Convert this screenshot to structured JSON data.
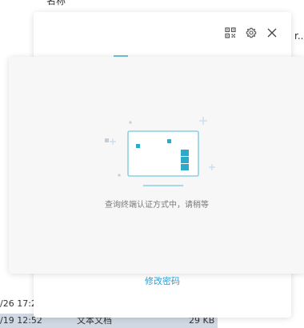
{
  "explorer": {
    "column_name": "名称",
    "right_text": "r...",
    "rows": [
      {
        "date": "/26 17:2",
        "type": "",
        "size": ""
      },
      {
        "date": "/19 12:52",
        "type": "文本文档",
        "size": "29 KB"
      }
    ]
  },
  "login_window": {
    "icons": [
      "qr-code-icon",
      "gear-icon",
      "close-icon"
    ],
    "change_password_label": "修改密码"
  },
  "auth_panel": {
    "status_text": "查询终端认证方式中，请稍等",
    "accent_color": "#2fa9c9"
  }
}
